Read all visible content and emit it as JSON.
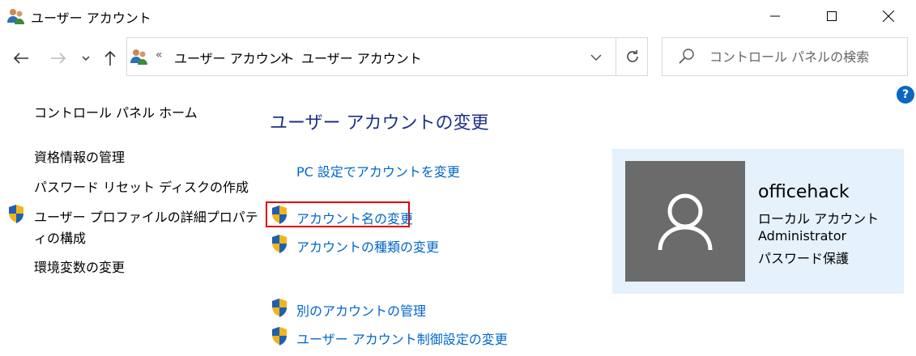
{
  "window": {
    "title": "ユーザー アカウント",
    "icon": "users-icon",
    "controls": [
      "minimize-icon",
      "maximize-icon",
      "close-icon"
    ]
  },
  "nav": {
    "breadcrumb_overflow": "«",
    "breadcrumb": [
      "ユーザー アカウント",
      "ユーザー アカウント"
    ],
    "search_placeholder": "コントロール パネルの検索",
    "icons": [
      "back-arrow-icon",
      "forward-arrow-icon",
      "chevron-down-icon",
      "up-arrow-icon",
      "refresh-icon",
      "search-icon",
      "help-icon"
    ]
  },
  "help": {
    "label": "?"
  },
  "left_pane": {
    "home": "コントロール パネル ホーム",
    "credentials": "資格情報の管理",
    "password_reset": "パスワード リセット ディスクの作成",
    "profile_line1": "ユーザー プロファイルの詳細プロパテ",
    "profile_line2": "ィの構成",
    "environment": "環境変数の変更"
  },
  "main": {
    "heading": "ユーザー アカウントの変更",
    "pc_settings": "PC 設定でアカウントを変更",
    "rename": "アカウント名の変更",
    "change_type": "アカウントの種類の変更",
    "manage_other": "別のアカウントの管理",
    "uac": "ユーザー アカウント制御設定の変更"
  },
  "user": {
    "name": "officehack",
    "account_type": "ローカル アカウント",
    "role": "Administrator",
    "password_status": "パスワード保護"
  },
  "colors": {
    "link": "#0066cc",
    "heading": "#1e3287",
    "highlight_border": "#e00000",
    "card_bg": "#e5f1fb",
    "avatar_bg": "#6b6b6b",
    "help_bg": "#0b67c2"
  }
}
